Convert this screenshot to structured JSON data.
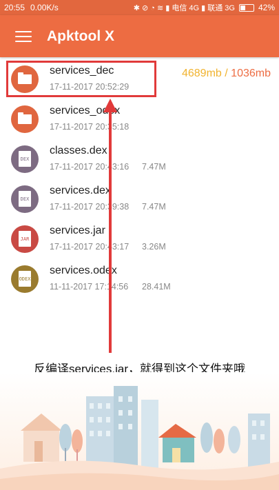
{
  "status_bar": {
    "time": "20:55",
    "speed": "0.00K/s",
    "icons_text": "✱ ⊘ ◔ ≋ ▮ 电信 4G ▮ 联通 3G",
    "battery": "42%",
    "battery_level": 0.42
  },
  "app": {
    "title": "Apktool X"
  },
  "storage": {
    "used": "4689mb",
    "separator": "/",
    "total": "1036mb"
  },
  "files": [
    {
      "name": "services_dec",
      "date": "17-11-2017  20:52:29",
      "size": "",
      "icon": "folder-icon",
      "color": "#e0663f"
    },
    {
      "name": "services_odex",
      "date": "17-11-2017  20:35:18",
      "size": "",
      "icon": "folder-icon",
      "color": "#e0663f"
    },
    {
      "name": "classes.dex",
      "date": "17-11-2017  20:43:16",
      "size": "7.47M",
      "icon": "dex-file-icon",
      "color": "#7d6b82"
    },
    {
      "name": "services.dex",
      "date": "17-11-2017  20:39:38",
      "size": "7.47M",
      "icon": "dex-file-icon",
      "color": "#7d6b82"
    },
    {
      "name": "services.jar",
      "date": "17-11-2017  20:43:17",
      "size": "3.26M",
      "icon": "jar-file-icon",
      "color": "#c94a44"
    },
    {
      "name": "services.odex",
      "date": "11-11-2017  17:14:56",
      "size": "28.41M",
      "icon": "odex-file-icon",
      "color": "#9a7b2e"
    }
  ],
  "file_badges": [
    "",
    "",
    "DEX",
    "DEX",
    "JAR",
    "ODEX"
  ],
  "caption": "反编译services.jar，就得到这个文件夹哦",
  "colors": {
    "appbar": "#ed6c42",
    "statusbar": "#e2673e",
    "annotation": "#e13a3a",
    "storage_used": "#f1b32f"
  }
}
